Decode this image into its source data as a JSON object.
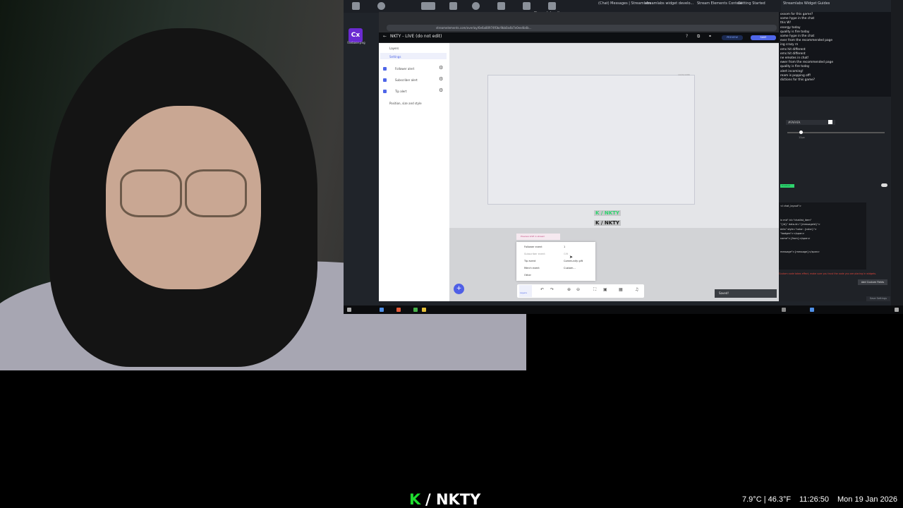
{
  "browser": {
    "tabs": [
      "(Chat) Messages | Streamlabs",
      "streamlabs widget develo...",
      "Stream Elements Content",
      "Getting Started",
      "Streamlabs Widget Guides"
    ],
    "url": "streamelements.com/overlay/6e6a80974f0bc9bb0a4b7e0ee4b4b...",
    "tab_title_center": "Streamlabs - live"
  },
  "desktop": {
    "icon_label": "Cx",
    "icon_caption": "Fanbase.png"
  },
  "app": {
    "title": "NKTY - LIVE (do not edit)",
    "preview_label": "PREVIEW",
    "save_label": "SAVE"
  },
  "sidebar": {
    "layers_label": "Layers",
    "settings_label": "Settings",
    "items": [
      {
        "label": "Follower alert"
      },
      {
        "label": "Subscriber alert"
      },
      {
        "label": "Tip alert"
      }
    ],
    "position_label": "Position, size and style"
  },
  "canvas": {
    "frame_label": "1920x1080",
    "logo_text": "K / NKTY",
    "logo_text_2": "K / NKTY"
  },
  "popup": {
    "header": "Preview LIVE in stream",
    "items": [
      "Follower event",
      "Subscriber event",
      "Tip event",
      "Merch event",
      "Other"
    ],
    "sub_items": [
      "1",
      "Gift",
      "Community gift",
      "Custom..."
    ]
  },
  "toolbar": {
    "layer_label": "Layers",
    "toast": "Saved!"
  },
  "chat": {
    "lines": [
      "ossom for this game?",
      "some hype in the chat",
      "this W!",
      "energy today",
      "quality is fire today",
      "some hype in the chat",
      "ever from the recommended page",
      "ing crazy rn",
      "ems hit different",
      "ems hit different",
      "ne emotes in chat!",
      "ewer from the recommended page",
      "quality is fire today",
      "alert incoming!",
      "ream is popping off!",
      "dictions for this game?"
    ],
    "color_value": "#FAFAFA",
    "size_label": "12px",
    "enabled_badge": "Enabled",
    "code_lines": [
      "<l chat_layout\">",
      "",
      "",
      "iv mb\" id=\"chatlist_item\"",
      "\"{id}\" data-id=\"{messageId}\">",
      "ents\" style=\"color: {color}\">",
      "\"badges\"></span>",
      "name\">{from}</span>",
      "",
      "",
      "message\">{message}</span>"
    ],
    "warning": "Custom code takes effect, make sure you trust the code you are placing in widgets.",
    "custom_fields_button": "Add Custom Fields",
    "save_settings_button": "Save Settings"
  },
  "stream_overlay": {
    "k": "K",
    "brand": "/ NKTY",
    "temperature": "7.9°C | 46.3°F",
    "time": "11:26:50",
    "date": "Mon 19 Jan 2026"
  },
  "colors": {
    "accent": "#4f66e8",
    "logo_green": "#1edc2f"
  }
}
